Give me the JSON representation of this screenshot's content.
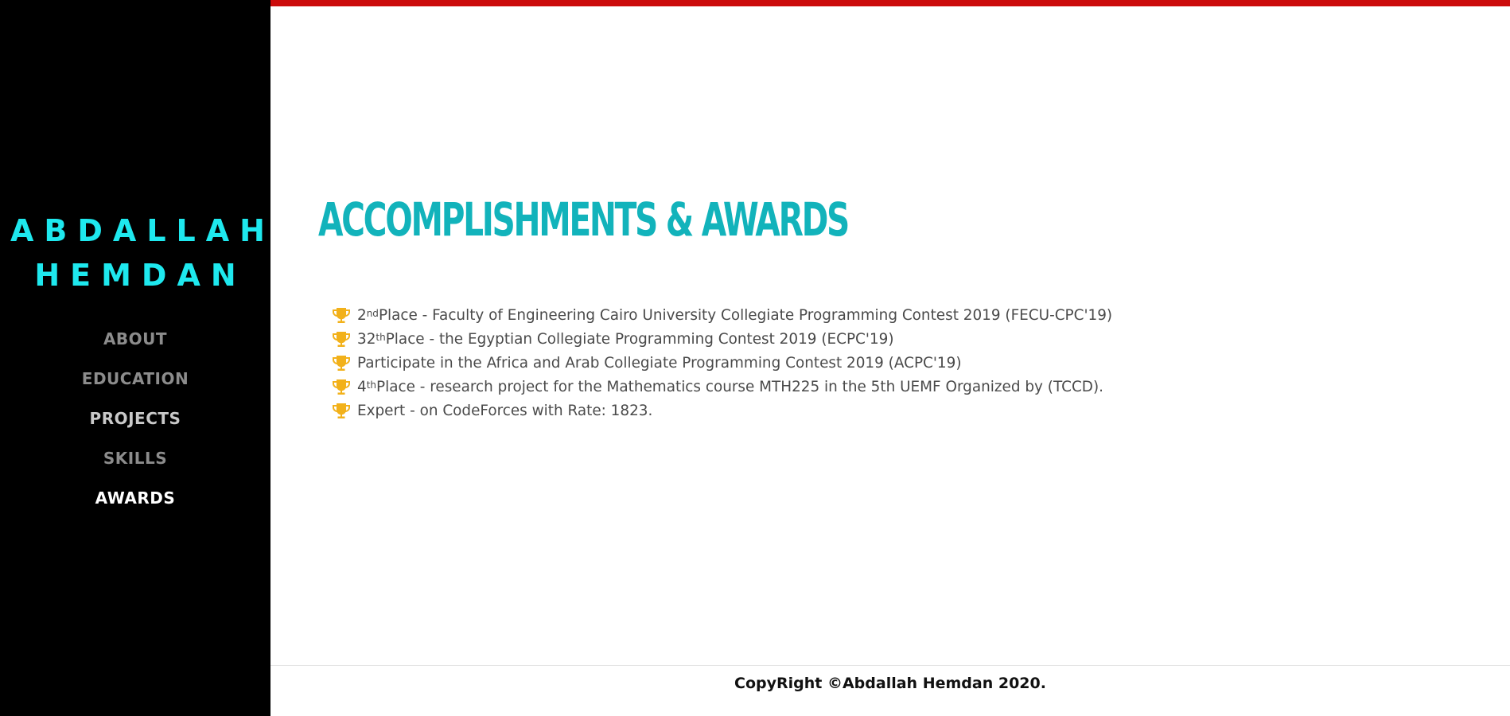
{
  "sidebar": {
    "brand_line1": "ABDALLAH",
    "brand_line2": "HEMDAN",
    "nav": {
      "about": "ABOUT",
      "education": "EDUCATION",
      "projects": "PROJECTS",
      "skills": "SKILLS",
      "awards": "AWARDS"
    }
  },
  "main": {
    "title": "ACCOMPLISHMENTS & AWARDS",
    "awards": [
      {
        "prefix": "2",
        "sup": "nd",
        "text": " Place - Faculty of Engineering Cairo University Collegiate Programming Contest 2019 (FECU-CPC'19)"
      },
      {
        "prefix": "32",
        "sup": "th",
        "text": " Place - the Egyptian Collegiate Programming Contest 2019 (ECPC'19)"
      },
      {
        "prefix": "",
        "sup": "",
        "text": "Participate in the Africa and Arab Collegiate Programming Contest 2019 (ACPC'19)"
      },
      {
        "prefix": "4",
        "sup": "th",
        "text": " Place - research project for the Mathematics course MTH225 in the 5th UEMF Organized by (TCCD)."
      },
      {
        "prefix": "",
        "sup": "",
        "text": "Expert - on CodeForces with Rate: 1823."
      }
    ],
    "icon": "trophy-icon"
  },
  "footer": {
    "text": "CopyRight ©Abdallah Hemdan 2020."
  },
  "colors": {
    "sidebar_bg": "#000000",
    "brand": "#1ee8ee",
    "heading": "#12b3bb",
    "top_bar": "#cc0c0c",
    "trophy": "#f2b11a"
  }
}
